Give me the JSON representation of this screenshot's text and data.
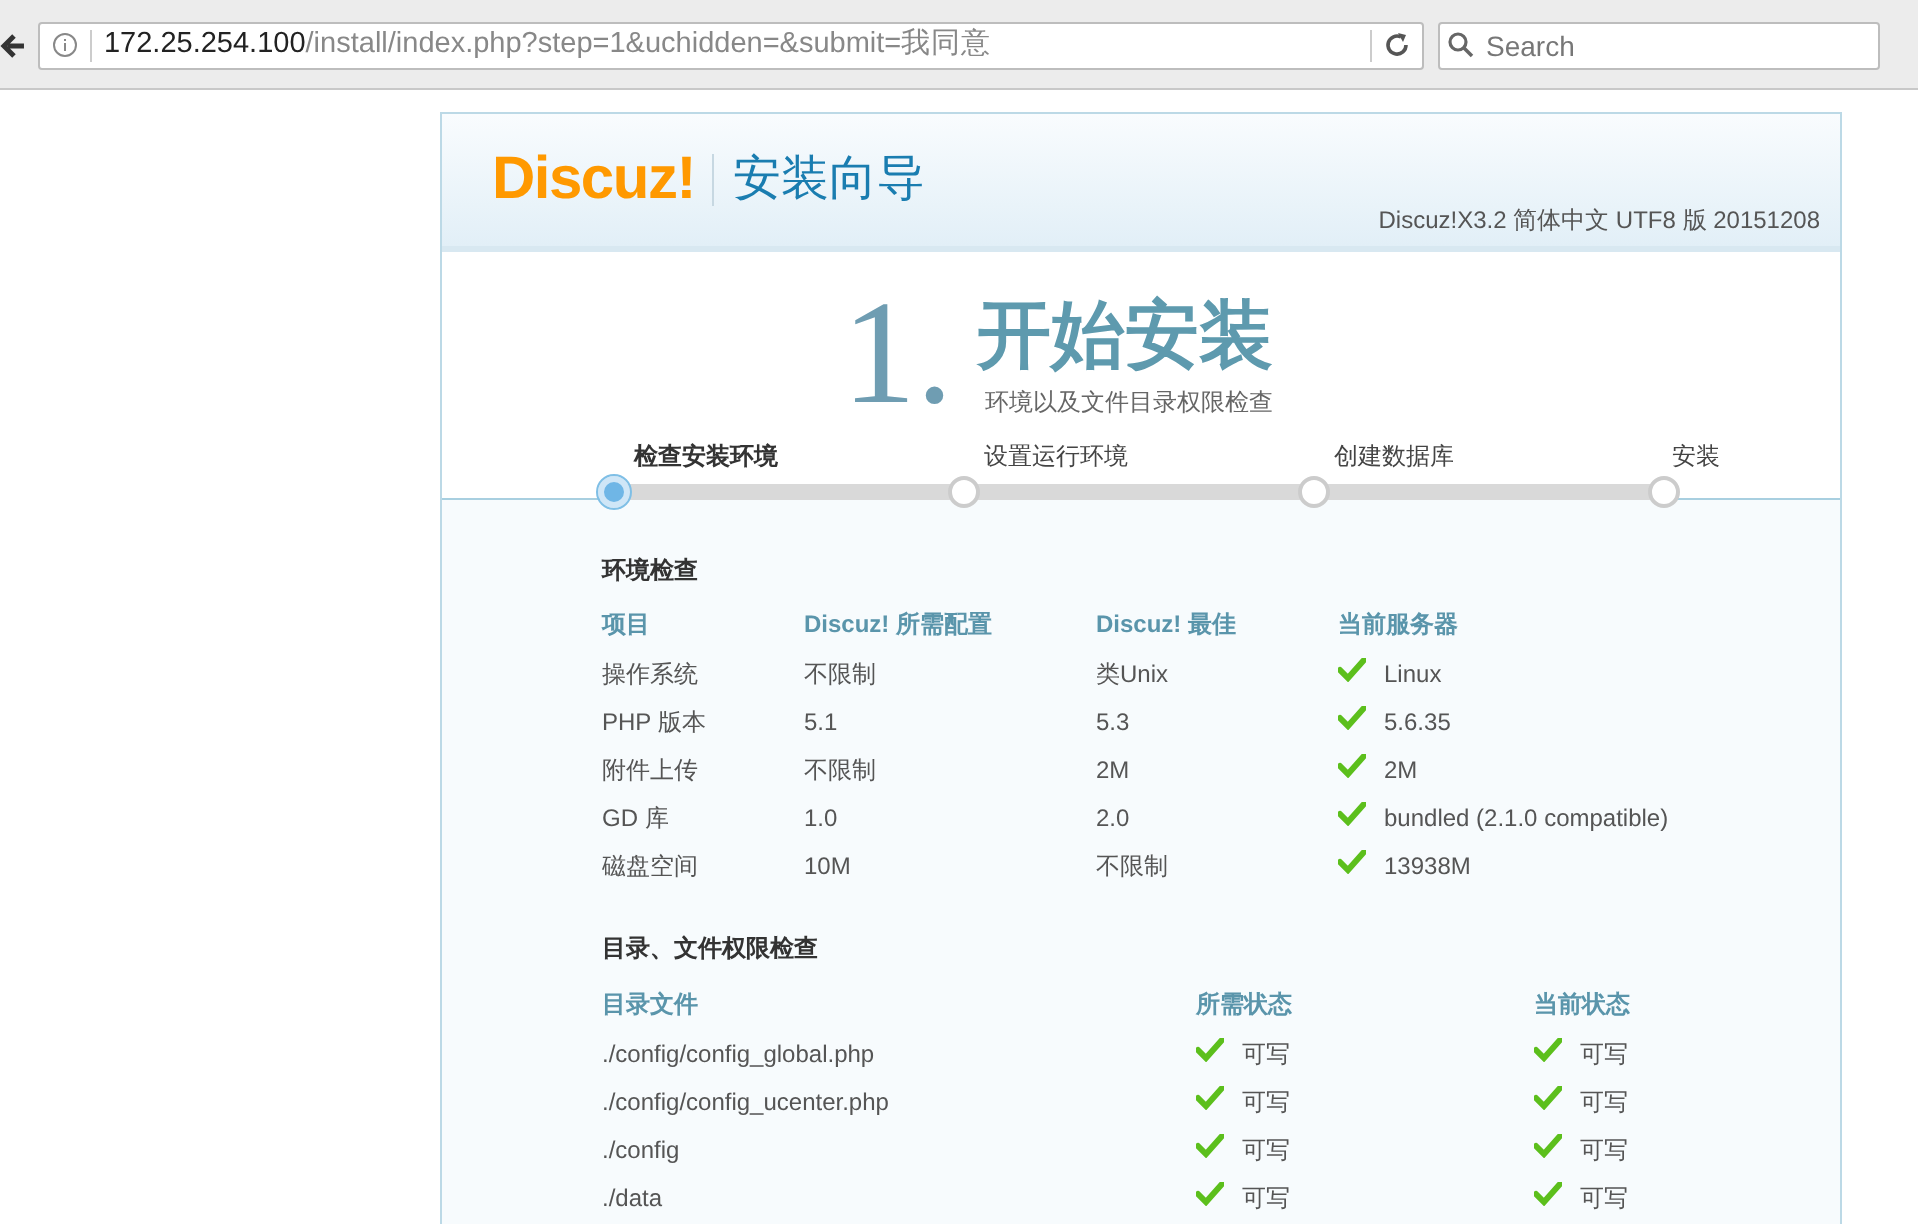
{
  "browser": {
    "url_host": "172.25.254.100",
    "url_path": "/install/index.php?step=1&uchidden=&submit=我同意",
    "search_placeholder": "Search"
  },
  "header": {
    "logo": "Discuz!",
    "title": "安装向导",
    "version": "Discuz!X3.2 简体中文 UTF8 版 20151208"
  },
  "step_heading": {
    "number": "1.",
    "title": "开始安装",
    "subtitle": "环境以及文件目录权限检查"
  },
  "steps": [
    {
      "label": "检查安装环境",
      "selected": true
    },
    {
      "label": "设置运行环境",
      "selected": false
    },
    {
      "label": "创建数据库",
      "selected": false
    },
    {
      "label": "安装",
      "selected": false
    }
  ],
  "env_check": {
    "title": "环境检查",
    "columns": [
      "项目",
      "Discuz! 所需配置",
      "Discuz! 最佳",
      "当前服务器"
    ],
    "rows": [
      {
        "item": "操作系统",
        "required": "不限制",
        "best": "类Unix",
        "current": "Linux",
        "ok": true
      },
      {
        "item": "PHP 版本",
        "required": "5.1",
        "best": "5.3",
        "current": "5.6.35",
        "ok": true
      },
      {
        "item": "附件上传",
        "required": "不限制",
        "best": "2M",
        "current": "2M",
        "ok": true
      },
      {
        "item": "GD 库",
        "required": "1.0",
        "best": "2.0",
        "current": "bundled (2.1.0 compatible)",
        "ok": true
      },
      {
        "item": "磁盘空间",
        "required": "10M",
        "best": "不限制",
        "current": "13938M",
        "ok": true
      }
    ]
  },
  "dir_check": {
    "title": "目录、文件权限检查",
    "columns": [
      "目录文件",
      "所需状态",
      "当前状态"
    ],
    "rows": [
      {
        "path": "./config/config_global.php",
        "required": "可写",
        "required_ok": true,
        "current": "可写",
        "current_ok": true
      },
      {
        "path": "./config/config_ucenter.php",
        "required": "可写",
        "required_ok": true,
        "current": "可写",
        "current_ok": true
      },
      {
        "path": "./config",
        "required": "可写",
        "required_ok": true,
        "current": "可写",
        "current_ok": true
      },
      {
        "path": "./data",
        "required": "可写",
        "required_ok": true,
        "current": "可写",
        "current_ok": true
      }
    ]
  }
}
